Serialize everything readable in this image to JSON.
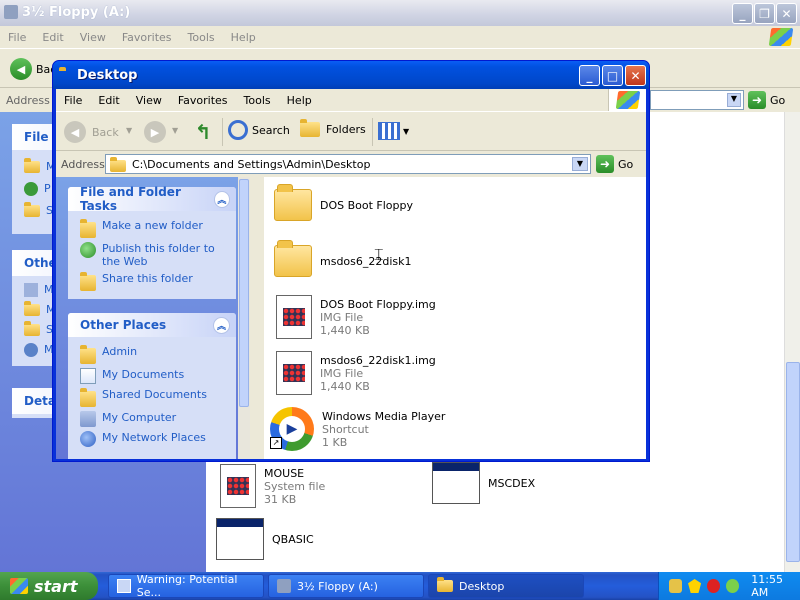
{
  "floppy_window": {
    "title": "3½ Floppy (A:)",
    "menu": [
      "File",
      "Edit",
      "View",
      "Favorites",
      "Tools",
      "Help"
    ],
    "back_label": "Back",
    "address_label": "Address",
    "go_label": "Go",
    "left_panels": {
      "panel1_title": "File a",
      "panel1_items": [
        "M",
        "P",
        "S"
      ],
      "panel2_title": "Othe",
      "panel2_items": [
        "M",
        "M",
        "S",
        "M"
      ],
      "panel3_title": "Deta"
    },
    "files": [
      {
        "name": "MOUSE",
        "type": "System file",
        "size": "31 KB"
      },
      {
        "name": "MSCDEX",
        "type": "",
        "size": ""
      },
      {
        "name": "QBASIC",
        "type": "",
        "size": ""
      }
    ]
  },
  "desktop_window": {
    "title": "Desktop",
    "menu": [
      "File",
      "Edit",
      "View",
      "Favorites",
      "Tools",
      "Help"
    ],
    "toolbar": {
      "back": "Back",
      "search": "Search",
      "folders": "Folders"
    },
    "address_label": "Address",
    "address_value": "C:\\Documents and Settings\\Admin\\Desktop",
    "go_label": "Go",
    "tasks": {
      "title": "File and Folder Tasks",
      "items": [
        "Make a new folder",
        "Publish this folder to the Web",
        "Share this folder"
      ]
    },
    "other_places": {
      "title": "Other Places",
      "items": [
        "Admin",
        "My Documents",
        "Shared Documents",
        "My Computer",
        "My Network Places"
      ]
    },
    "files": [
      {
        "name": "DOS Boot Floppy",
        "type": "",
        "size": "",
        "icon": "folder-icon"
      },
      {
        "name": "msdos6_22disk1",
        "type": "",
        "size": "",
        "icon": "folder-icon"
      },
      {
        "name": "DOS Boot Floppy.img",
        "type": "IMG File",
        "size": "1,440 KB",
        "icon": "img-file-icon"
      },
      {
        "name": "msdos6_22disk1.img",
        "type": "IMG File",
        "size": "1,440 KB",
        "icon": "img-file-icon"
      },
      {
        "name": "Windows Media Player",
        "type": "Shortcut",
        "size": "1 KB",
        "icon": "media-player-icon"
      }
    ]
  },
  "taskbar": {
    "start_label": "start",
    "buttons": [
      "Warning: Potential Se...",
      "3½ Floppy (A:)",
      "Desktop"
    ],
    "clock": "11:55 AM"
  },
  "colors": {
    "xp_blue": "#0054e3",
    "taskpane_link": "#215dc6",
    "start_green": "#3c8f39"
  }
}
